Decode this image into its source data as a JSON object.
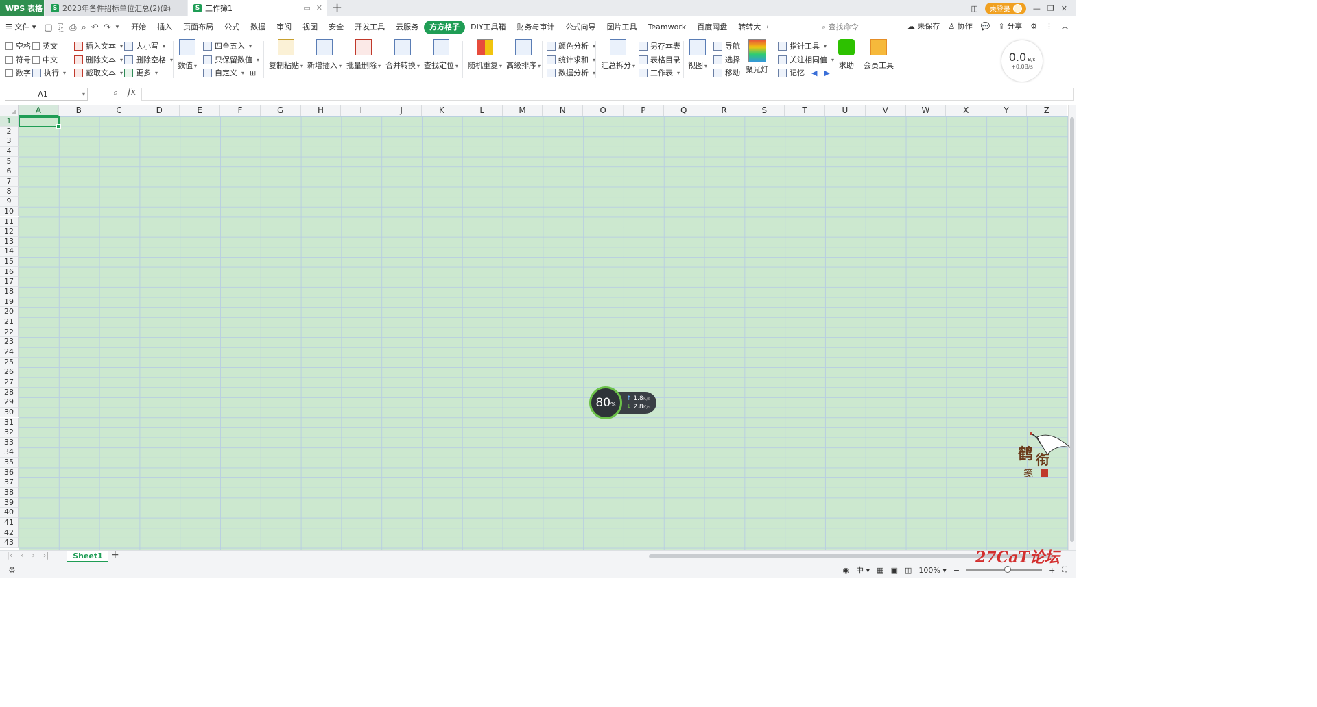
{
  "titlebar": {
    "app_tab": "WPS 表格",
    "tabs": [
      {
        "label": "2023年备件招标单位汇总(2)(2)"
      },
      {
        "label": "工作簿1"
      }
    ],
    "login_label": "未登录"
  },
  "menu": {
    "file": "文件",
    "items": [
      "开始",
      "插入",
      "页面布局",
      "公式",
      "数据",
      "审阅",
      "视图",
      "安全",
      "开发工具",
      "云服务",
      "方方格子",
      "DIY工具箱",
      "财务与审计",
      "公式向导",
      "图片工具",
      "Teamwork",
      "百度网盘",
      "转转大"
    ],
    "active": "方方格子",
    "search_placeholder": "查找命令",
    "right": {
      "unsaved": "未保存",
      "collab": "协作",
      "share": "分享"
    }
  },
  "ribbon": {
    "checks": [
      "空格",
      "符号",
      "数字",
      "英文",
      "中文"
    ],
    "exec": "执行",
    "text_ops": [
      "插入文本",
      "删除文本",
      "截取文本"
    ],
    "case_ops": [
      "大小写",
      "删除空格",
      "更多"
    ],
    "value": "数值",
    "round_ops": [
      "四舍五入",
      "只保留数值",
      "自定义"
    ],
    "big": [
      "复制粘贴",
      "新增插入",
      "批量删除",
      "合并转换",
      "查找定位",
      "随机重复",
      "高级排序"
    ],
    "analysis": [
      "颜色分析",
      "统计求和",
      "数据分析"
    ],
    "summary": "汇总拆分",
    "sheet_ops": [
      "另存本表",
      "表格目录",
      "工作表"
    ],
    "view": "视图",
    "nav_ops": [
      "导航",
      "选择",
      "移动"
    ],
    "spotlight": "聚光灯",
    "pointer_ops": [
      "指针工具",
      "关注相同值",
      "记忆"
    ],
    "help": "求助",
    "member": "会员工具",
    "speed": {
      "value": "0.0",
      "unit": "B/s",
      "sub": "+0.0B/s"
    }
  },
  "formula": {
    "cell": "A1",
    "fx": "fx",
    "value": ""
  },
  "grid": {
    "columns": [
      "A",
      "B",
      "C",
      "D",
      "E",
      "F",
      "G",
      "H",
      "I",
      "J",
      "K",
      "L",
      "M",
      "N",
      "O",
      "P",
      "Q",
      "R",
      "S",
      "T",
      "U",
      "V",
      "W",
      "X",
      "Y",
      "Z"
    ],
    "rows": [
      "1",
      "2",
      "3",
      "4",
      "5",
      "6",
      "7",
      "8",
      "9",
      "10",
      "11",
      "12",
      "13",
      "14",
      "15",
      "16",
      "17",
      "18",
      "19",
      "20",
      "21",
      "22",
      "23",
      "24",
      "25",
      "26",
      "27",
      "28",
      "29",
      "30",
      "31",
      "32",
      "33",
      "34",
      "35",
      "36",
      "37",
      "38",
      "39",
      "40",
      "41",
      "42",
      "43"
    ],
    "selected": "A1"
  },
  "sheets": {
    "tabs": [
      "Sheet1"
    ]
  },
  "status": {
    "zoom": "100%",
    "input_mode": "中"
  },
  "net_widget": {
    "percent": "80",
    "up": "1.8",
    "down": "2.8",
    "unit": "K/s"
  },
  "watermark": {
    "brand": "27CaT论坛"
  },
  "colors": {
    "accent": "#1f9d55",
    "grid_bg": "#cce8cf",
    "grid_line": "#b9cfe0",
    "login": "#f0a020"
  }
}
